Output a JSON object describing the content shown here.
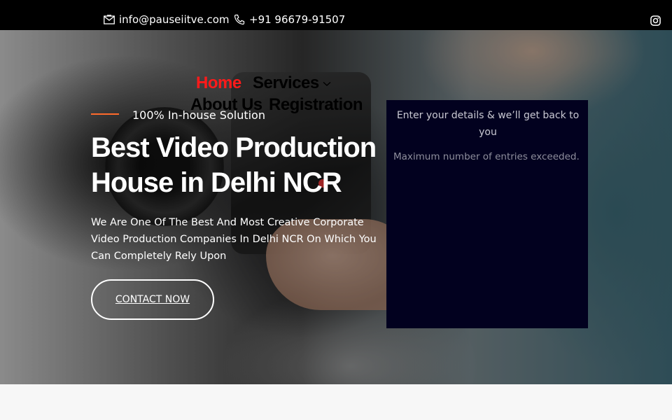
{
  "topbar": {
    "email": "info@pauseiitve.com",
    "phone": "+91 96679-91507",
    "social_icon": "instagram-icon"
  },
  "nav": {
    "home": "Home",
    "services": "Services",
    "about": "About Us",
    "registration": "Registration"
  },
  "hero": {
    "tagline": "100% In-house Solution",
    "headline_line1": "Best Video Production",
    "headline_line2": "House in Delhi NCR",
    "subtext": "We Are One Of The Best And Most Creative Corporate Video Production Companies In Delhi NCR On Which You Can Completely Rely Upon",
    "cta_label": "CONTACT NOW"
  },
  "form": {
    "title": "Enter your details & we’ll get back to you",
    "message": "Maximum number of entries exceeded."
  },
  "colors": {
    "accent": "#ff1a1a",
    "tag_line": "#ff6a2b",
    "form_bg": "#02011f",
    "topbar_bg": "#000000"
  }
}
